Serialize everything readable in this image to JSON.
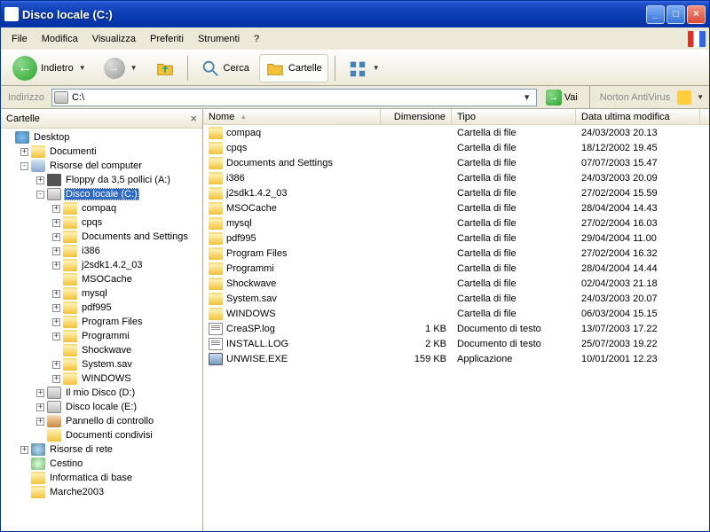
{
  "window": {
    "title": "Disco locale (C:)"
  },
  "menubar": [
    "File",
    "Modifica",
    "Visualizza",
    "Preferiti",
    "Strumenti",
    "?"
  ],
  "toolbar": {
    "back": "Indietro",
    "search": "Cerca",
    "folders": "Cartelle"
  },
  "addressbar": {
    "label": "Indirizzo",
    "value": "C:\\",
    "go": "Vai",
    "norton": "Norton AntiVirus"
  },
  "sidebar": {
    "title": "Cartelle"
  },
  "tree": [
    {
      "indent": 0,
      "toggle": "",
      "icon": "ico-desktop",
      "label": "Desktop"
    },
    {
      "indent": 1,
      "toggle": "+",
      "icon": "ico-folder",
      "label": "Documenti"
    },
    {
      "indent": 1,
      "toggle": "-",
      "icon": "ico-mycomputer",
      "label": "Risorse del computer"
    },
    {
      "indent": 2,
      "toggle": "+",
      "icon": "ico-floppy",
      "label": "Floppy da 3,5 pollici (A:)"
    },
    {
      "indent": 2,
      "toggle": "-",
      "icon": "ico-drive",
      "label": "Disco locale (C:)",
      "selected": true
    },
    {
      "indent": 3,
      "toggle": "+",
      "icon": "ico-folder",
      "label": "compaq"
    },
    {
      "indent": 3,
      "toggle": "+",
      "icon": "ico-folder",
      "label": "cpqs"
    },
    {
      "indent": 3,
      "toggle": "+",
      "icon": "ico-folder",
      "label": "Documents and Settings"
    },
    {
      "indent": 3,
      "toggle": "+",
      "icon": "ico-folder",
      "label": "i386"
    },
    {
      "indent": 3,
      "toggle": "+",
      "icon": "ico-folder",
      "label": "j2sdk1.4.2_03"
    },
    {
      "indent": 3,
      "toggle": "",
      "icon": "ico-folder",
      "label": "MSOCache"
    },
    {
      "indent": 3,
      "toggle": "+",
      "icon": "ico-folder",
      "label": "mysql"
    },
    {
      "indent": 3,
      "toggle": "+",
      "icon": "ico-folder",
      "label": "pdf995"
    },
    {
      "indent": 3,
      "toggle": "+",
      "icon": "ico-folder",
      "label": "Program Files"
    },
    {
      "indent": 3,
      "toggle": "+",
      "icon": "ico-folder",
      "label": "Programmi"
    },
    {
      "indent": 3,
      "toggle": "",
      "icon": "ico-folder",
      "label": "Shockwave"
    },
    {
      "indent": 3,
      "toggle": "+",
      "icon": "ico-folder",
      "label": "System.sav"
    },
    {
      "indent": 3,
      "toggle": "+",
      "icon": "ico-folder",
      "label": "WINDOWS"
    },
    {
      "indent": 2,
      "toggle": "+",
      "icon": "ico-drive",
      "label": "Il mio Disco (D:)"
    },
    {
      "indent": 2,
      "toggle": "+",
      "icon": "ico-drive",
      "label": "Disco locale (E:)"
    },
    {
      "indent": 2,
      "toggle": "+",
      "icon": "ico-panel",
      "label": "Pannello di controllo"
    },
    {
      "indent": 2,
      "toggle": "",
      "icon": "ico-shared",
      "label": "Documenti condivisi"
    },
    {
      "indent": 1,
      "toggle": "+",
      "icon": "ico-network",
      "label": "Risorse di rete"
    },
    {
      "indent": 1,
      "toggle": "",
      "icon": "ico-recycle",
      "label": "Cestino"
    },
    {
      "indent": 1,
      "toggle": "",
      "icon": "ico-folder",
      "label": "Informatica di base"
    },
    {
      "indent": 1,
      "toggle": "",
      "icon": "ico-folder",
      "label": "Marche2003"
    }
  ],
  "columns": {
    "name": "Nome",
    "size": "Dimensione",
    "type": "Tipo",
    "date": "Data ultima modifica"
  },
  "files": [
    {
      "icon": "fico-folder",
      "name": "compaq",
      "size": "",
      "type": "Cartella di file",
      "date": "24/03/2003 20.13"
    },
    {
      "icon": "fico-folder",
      "name": "cpqs",
      "size": "",
      "type": "Cartella di file",
      "date": "18/12/2002 19.45"
    },
    {
      "icon": "fico-folder",
      "name": "Documents and Settings",
      "size": "",
      "type": "Cartella di file",
      "date": "07/07/2003 15.47"
    },
    {
      "icon": "fico-folder",
      "name": "i386",
      "size": "",
      "type": "Cartella di file",
      "date": "24/03/2003 20.09"
    },
    {
      "icon": "fico-folder",
      "name": "j2sdk1.4.2_03",
      "size": "",
      "type": "Cartella di file",
      "date": "27/02/2004 15.59"
    },
    {
      "icon": "fico-folder",
      "name": "MSOCache",
      "size": "",
      "type": "Cartella di file",
      "date": "28/04/2004 14.43"
    },
    {
      "icon": "fico-folder",
      "name": "mysql",
      "size": "",
      "type": "Cartella di file",
      "date": "27/02/2004 16.03"
    },
    {
      "icon": "fico-folder",
      "name": "pdf995",
      "size": "",
      "type": "Cartella di file",
      "date": "29/04/2004 11.00"
    },
    {
      "icon": "fico-folder",
      "name": "Program Files",
      "size": "",
      "type": "Cartella di file",
      "date": "27/02/2004 16.32"
    },
    {
      "icon": "fico-folder",
      "name": "Programmi",
      "size": "",
      "type": "Cartella di file",
      "date": "28/04/2004 14.44"
    },
    {
      "icon": "fico-folder",
      "name": "Shockwave",
      "size": "",
      "type": "Cartella di file",
      "date": "02/04/2003 21.18"
    },
    {
      "icon": "fico-folder",
      "name": "System.sav",
      "size": "",
      "type": "Cartella di file",
      "date": "24/03/2003 20.07"
    },
    {
      "icon": "fico-folder",
      "name": "WINDOWS",
      "size": "",
      "type": "Cartella di file",
      "date": "06/03/2004 15.15"
    },
    {
      "icon": "fico-text",
      "name": "CreaSP.log",
      "size": "1 KB",
      "type": "Documento di testo",
      "date": "13/07/2003 17.22"
    },
    {
      "icon": "fico-text",
      "name": "INSTALL.LOG",
      "size": "2 KB",
      "type": "Documento di testo",
      "date": "25/07/2003 19.22"
    },
    {
      "icon": "fico-exe",
      "name": "UNWISE.EXE",
      "size": "159 KB",
      "type": "Applicazione",
      "date": "10/01/2001 12.23"
    }
  ]
}
